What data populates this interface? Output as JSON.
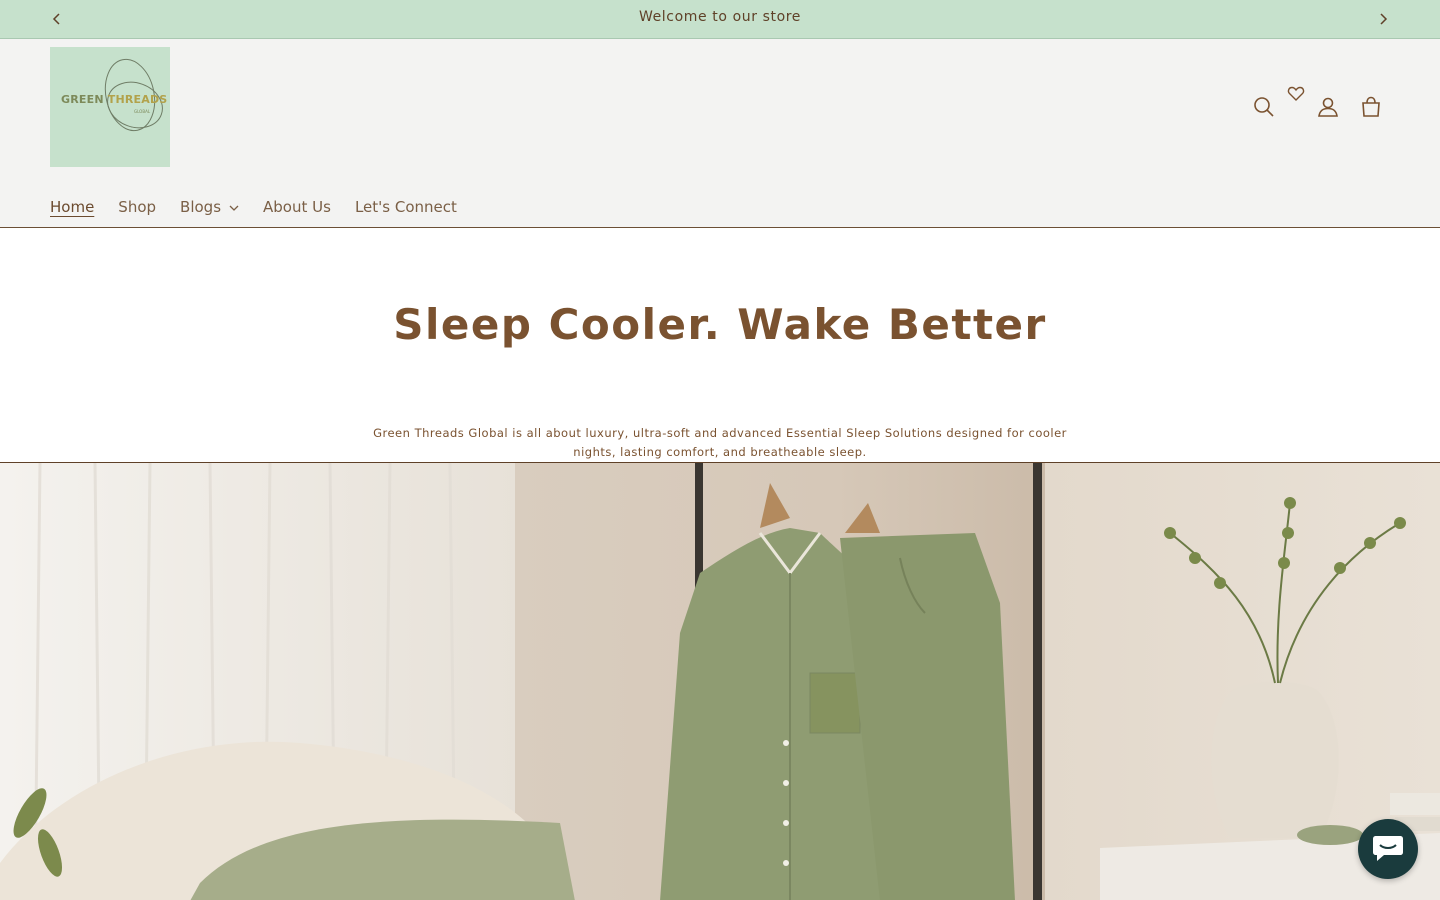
{
  "announcement": {
    "message": "Welcome to our store",
    "prev_icon": "chevron-left-icon",
    "next_icon": "chevron-right-icon"
  },
  "brand": {
    "logo_word1": "GREEN",
    "logo_word2": "THREADS",
    "logo_sub": "GLOBAL",
    "logo_bg": "#c6e1cc"
  },
  "header_icons": [
    "search-icon",
    "heart-icon",
    "account-icon",
    "cart-icon"
  ],
  "nav": {
    "items": [
      {
        "label": "Home"
      },
      {
        "label": "Shop"
      },
      {
        "label": "Blogs"
      },
      {
        "label": "About Us"
      },
      {
        "label": "Let's Connect"
      }
    ]
  },
  "hero": {
    "title": "Sleep Cooler. Wake Better",
    "description": "Green Threads Global is all about luxury, ultra-soft and advanced Essential Sleep Solutions designed for cooler nights, lasting comfort, and breatheable sleep."
  },
  "colors": {
    "announcement_bg": "#c6e1cc",
    "header_bg": "#f3f3f2",
    "text_brown": "#7a5230",
    "chat_bg": "#1a3b3d"
  },
  "chat": {
    "icon": "chat-bubble-icon"
  }
}
